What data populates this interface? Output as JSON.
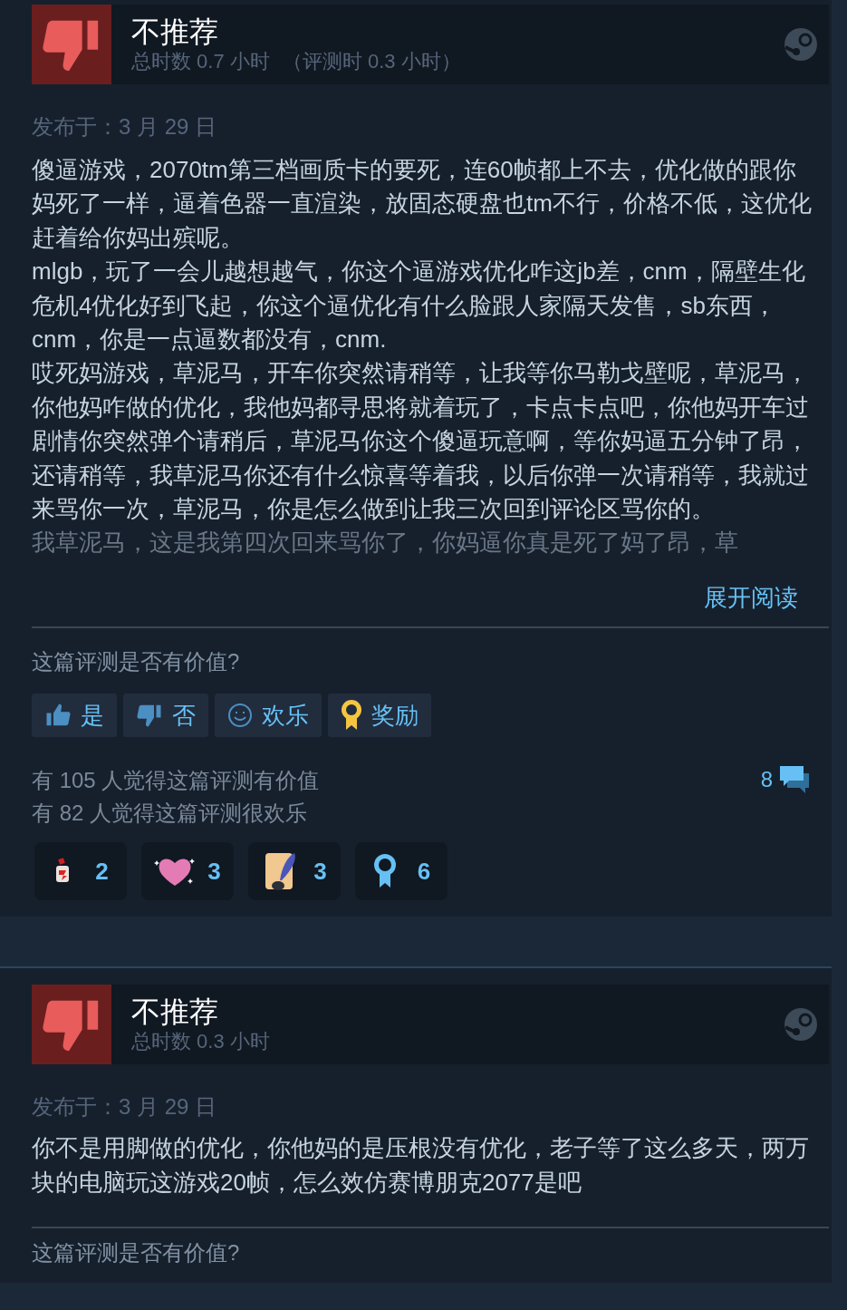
{
  "reviews": [
    {
      "verdict": "不推荐",
      "recommended": false,
      "hours": "总时数 0.7 小时",
      "review_hours": "（评测时 0.3 小时）",
      "posted": "发布于：3 月 29 日",
      "paragraphs": [
        "傻逼游戏，2070tm第三档画质卡的要死，连60帧都上不去，优化做的跟你妈死了一样，逼着色器一直渲染，放固态硬盘也tm不行，价格不低，这优化赶着给你妈出殡呢。",
        "mlgb，玩了一会儿越想越气，你这个逼游戏优化咋这jb差，cnm，隔壁生化危机4优化好到飞起，你这个逼优化有什么脸跟人家隔天发售，sb东西，cnm，你是一点逼数都没有，cnm.",
        "哎死妈游戏，草泥马，开车你突然请稍等，让我等你马勒戈壁呢，草泥马，你他妈咋做的优化，我他妈都寻思将就着玩了，卡点卡点吧，你他妈开车过剧情你突然弹个请稍后，草泥马你这个傻逼玩意啊，等你妈逼五分钟了昂，还请稍等，我草泥马你还有什么惊喜等着我，以后你弹一次请稍等，我就过来骂你一次，草泥马，你是怎么做到让我三次回到评论区骂你的。"
      ],
      "faded_line": "我草泥马，这是我第四次回来骂你了，你妈逼你真是死了妈了昂，草",
      "expand_link": "展开阅读",
      "helpful_prompt": "这篇评测是否有价值?",
      "vote_buttons": [
        {
          "kind": "yes",
          "label": "是"
        },
        {
          "kind": "no",
          "label": "否"
        },
        {
          "kind": "funny",
          "label": "欢乐"
        },
        {
          "kind": "award",
          "label": "奖励"
        }
      ],
      "helpful_count": "有 105 人觉得这篇评测有价值",
      "funny_count": "有 82 人觉得这篇评测很欢乐",
      "comment_count": "8",
      "awards": [
        {
          "kind": "bottle",
          "count": "2"
        },
        {
          "kind": "heart",
          "count": "3"
        },
        {
          "kind": "scroll",
          "count": "3"
        },
        {
          "kind": "ribbon",
          "count": "6"
        }
      ]
    },
    {
      "verdict": "不推荐",
      "recommended": false,
      "hours": "总时数 0.3 小时",
      "posted": "发布于：3 月 29 日",
      "paragraphs": [
        "你不是用脚做的优化，你他妈的是压根没有优化，老子等了这么多天，两万块的电脑玩这游戏20帧，怎么效仿赛博朋克2077是吧"
      ],
      "helpful_prompt": "这篇评测是否有价值?"
    }
  ]
}
